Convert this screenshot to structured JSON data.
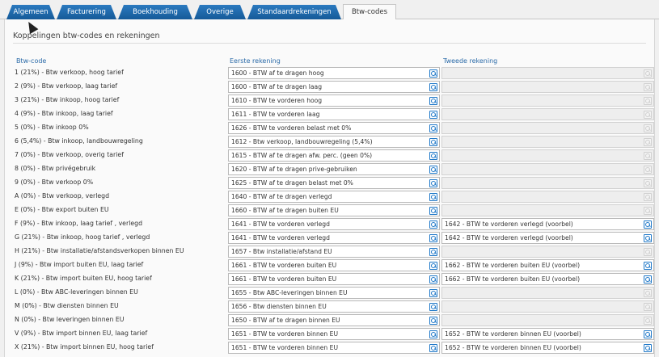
{
  "tabs": [
    {
      "label": "Algemeen",
      "active": false
    },
    {
      "label": "Facturering",
      "active": false
    },
    {
      "label": "Boekhouding",
      "active": false
    },
    {
      "label": "Overige",
      "active": false
    },
    {
      "label": "Standaardrekeningen",
      "active": false
    },
    {
      "label": "Btw-codes",
      "active": true
    }
  ],
  "section": {
    "title": "Koppelingen btw-codes en rekeningen"
  },
  "columns": {
    "code": "Btw-code",
    "first": "Eerste rekening",
    "second": "Tweede rekening"
  },
  "rows": [
    {
      "code": "1 (21%) - Btw verkoop, hoog tarief",
      "first": "1600 - BTW af te dragen hoog",
      "second": ""
    },
    {
      "code": "2 (9%) - Btw verkoop, laag tarief",
      "first": "1600 - BTW af te dragen laag",
      "second": ""
    },
    {
      "code": "3 (21%) - Btw inkoop, hoog tarief",
      "first": "1610 - BTW te vorderen hoog",
      "second": ""
    },
    {
      "code": "4 (9%) - Btw inkoop, laag tarief",
      "first": "1611 - BTW te vorderen laag",
      "second": ""
    },
    {
      "code": "5 (0%) - Btw inkoop 0%",
      "first": "1626 - BTW te vorderen belast met 0%",
      "second": ""
    },
    {
      "code": "6 (5,4%) - Btw inkoop, landbouwregeling",
      "first": "1612 - Btw verkoop, landbouwregeling (5,4%)",
      "second": ""
    },
    {
      "code": "7 (0%) - Btw verkoop, overig tarief",
      "first": "1615 - BTW af te dragen afw. perc. (geen 0%)",
      "second": ""
    },
    {
      "code": "8 (0%) - Btw privégebruik",
      "first": "1620 - BTW af te dragen prive-gebruiken",
      "second": ""
    },
    {
      "code": "9 (0%) - Btw verkoop 0%",
      "first": "1625 - BTW af te dragen belast met 0%",
      "second": ""
    },
    {
      "code": "A (0%) - Btw verkoop, verlegd",
      "first": "1640 - BTW af te dragen verlegd",
      "second": ""
    },
    {
      "code": "E (0%) - Btw export buiten EU",
      "first": "1660 - BTW af te dragen buiten EU",
      "second": ""
    },
    {
      "code": "F (9%) - Btw inkoop, laag tarief , verlegd",
      "first": "1641 - BTW te vorderen verlegd",
      "second": "1642 - BTW te vorderen verlegd (voorbel)"
    },
    {
      "code": "G (21%) - Btw inkoop, hoog tarief , verlegd",
      "first": "1641 - BTW te vorderen verlegd",
      "second": "1642 - BTW te vorderen verlegd (voorbel)"
    },
    {
      "code": "H (21%) - Btw installatie/afstandsverkopen binnen EU",
      "first": "1657 - Btw installatie/afstand EU",
      "second": ""
    },
    {
      "code": "J (9%) - Btw import buiten EU, laag tarief",
      "first": "1661 - BTW te vorderen buiten EU",
      "second": "1662 - BTW te vorderen buiten EU (voorbel)"
    },
    {
      "code": "K (21%) - Btw import buiten EU, hoog tarief",
      "first": "1661 - BTW te vorderen buiten EU",
      "second": "1662 - BTW te vorderen buiten EU (voorbel)"
    },
    {
      "code": "L (0%) - Btw ABC-leveringen binnen EU",
      "first": "1655 - Btw ABC-leveringen binnen EU",
      "second": ""
    },
    {
      "code": "M (0%) - Btw diensten binnen EU",
      "first": "1656 - Btw diensten binnen EU",
      "second": ""
    },
    {
      "code": "N (0%) - Btw leveringen binnen EU",
      "first": "1650 - BTW af te dragen binnen EU",
      "second": ""
    },
    {
      "code": "V (9%) - Btw import binnen EU, laag tarief",
      "first": "1651 - BTW te vorderen binnen EU",
      "second": "1652 - BTW te vorderen binnen EU (voorbel)"
    },
    {
      "code": "X (21%) - Btw import binnen EU, hoog tarief",
      "first": "1651 - BTW te vorderen binnen EU",
      "second": "1652 - BTW te vorderen binnen EU (voorbel)"
    }
  ],
  "icons": {
    "lookup": "lookup-icon",
    "cursor": "mouse-pointer-icon"
  },
  "colors": {
    "tab": "#1e6ab0",
    "header": "#2a6aa8",
    "lookup": "#1f78c8"
  }
}
